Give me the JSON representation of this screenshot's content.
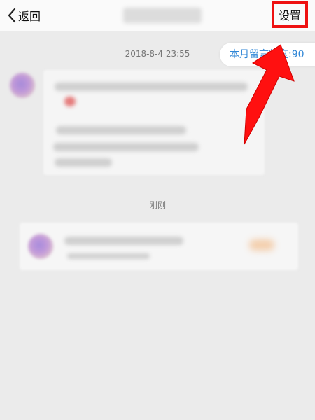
{
  "nav": {
    "back_label": "返回",
    "settings_label": "设置"
  },
  "chat": {
    "timestamp": "2018-8-4 23:55",
    "quota_text": "本月留言额度:90",
    "section_time": "刚刚"
  },
  "colors": {
    "nav_bg": "#fafafa",
    "page_bg": "#ebebeb",
    "link_blue": "#2f86d6",
    "highlight_red": "#ee1111"
  },
  "icons": {
    "back": "chevron-left-icon",
    "annotation": "red-arrow-icon"
  }
}
